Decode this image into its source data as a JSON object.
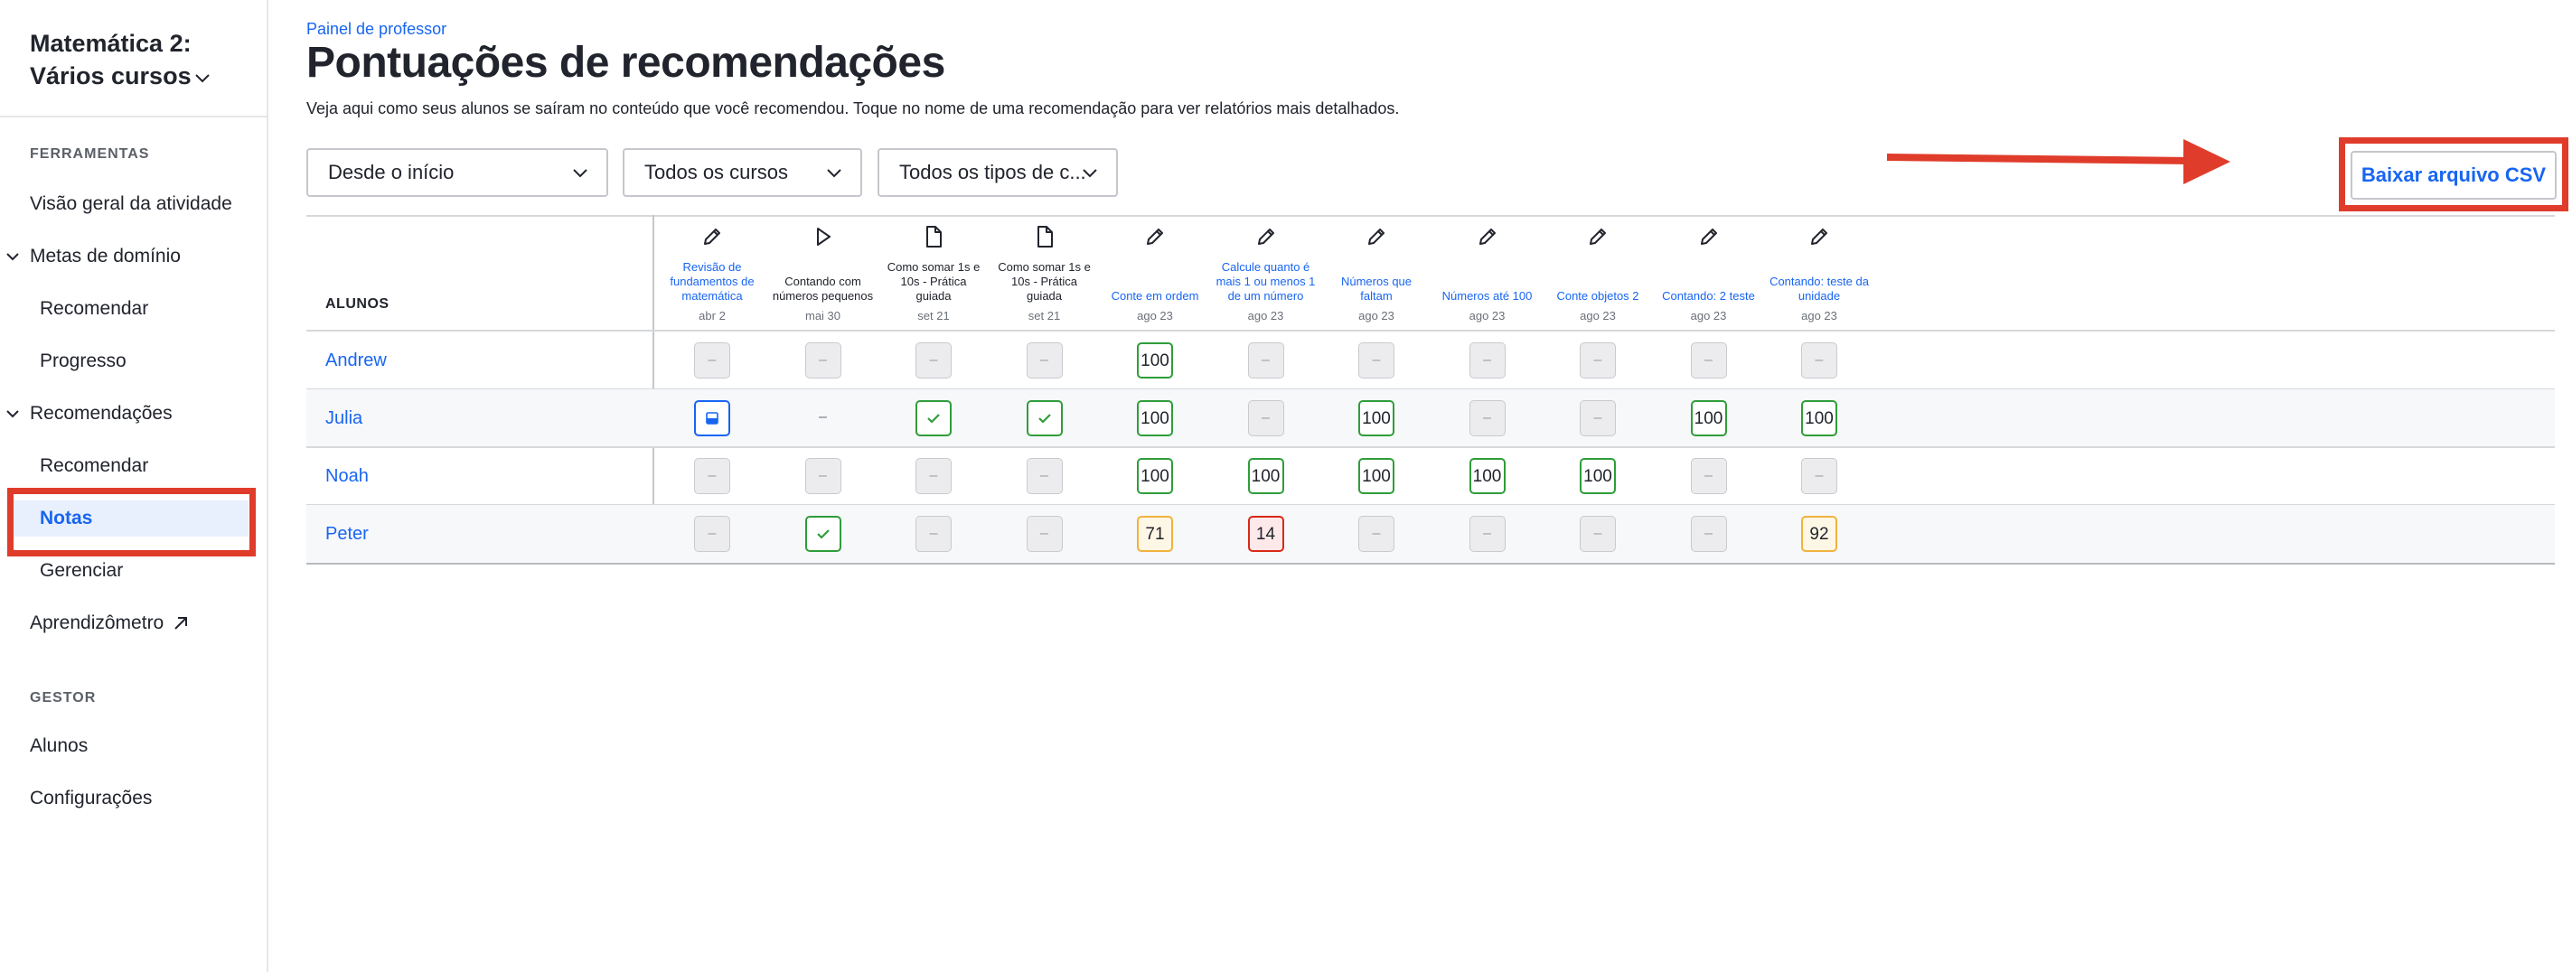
{
  "sidebar": {
    "course_title_line1": "Matemática 2:",
    "course_title_line2": "Vários cursos",
    "section_tools": "FERRAMENTAS",
    "activity_overview": "Visão geral da atividade",
    "mastery_goals": "Metas de domínio",
    "mastery_recommend": "Recomendar",
    "mastery_progress": "Progresso",
    "recommendations": "Recomendações",
    "rec_recommend": "Recomendar",
    "rec_grades": "Notas",
    "rec_manage": "Gerenciar",
    "learnometer": "Aprendizômetro",
    "section_manager": "GESTOR",
    "students": "Alunos",
    "settings": "Configurações"
  },
  "header": {
    "breadcrumb": "Painel de professor",
    "title": "Pontuações de recomendações",
    "description": "Veja aqui como seus alunos se saíram no conteúdo que você recomendou. Toque no nome de uma recomendação para ver relatórios mais detalhados."
  },
  "filters": {
    "period": "Desde o início",
    "courses": "Todos os cursos",
    "types": "Todos os tipos de c..."
  },
  "csv_button": "Baixar arquivo CSV",
  "colors": {
    "link_blue": "#1865f2",
    "annotation_red": "#e03c2b",
    "score_green": "#2f9d3a",
    "score_yellow": "#f0b33c",
    "score_red": "#d92916"
  },
  "table": {
    "students_header": "ALUNOS",
    "assignments": [
      {
        "icon": "pencil-icon",
        "lines": [
          "Revisão de",
          "fundamentos de",
          "matemática"
        ],
        "date": "abr 2",
        "link": true
      },
      {
        "icon": "play-icon",
        "lines": [
          "Contando com",
          "números pequenos"
        ],
        "date": "mai 30",
        "link": false
      },
      {
        "icon": "document-icon",
        "lines": [
          "Como somar 1s e",
          "10s - Prática",
          "guiada"
        ],
        "date": "set 21",
        "link": false
      },
      {
        "icon": "document-icon",
        "lines": [
          "Como somar 1s e",
          "10s - Prática",
          "guiada"
        ],
        "date": "set 21",
        "link": false
      },
      {
        "icon": "pencil-icon",
        "lines": [
          "Conte em ordem"
        ],
        "date": "ago 23",
        "link": true
      },
      {
        "icon": "pencil-icon",
        "lines": [
          "Calcule quanto é",
          "mais 1 ou menos 1",
          "de um número"
        ],
        "date": "ago 23",
        "link": true
      },
      {
        "icon": "pencil-icon",
        "lines": [
          "Números que",
          "faltam"
        ],
        "date": "ago 23",
        "link": true
      },
      {
        "icon": "pencil-icon",
        "lines": [
          "Números até 100"
        ],
        "date": "ago 23",
        "link": true
      },
      {
        "icon": "pencil-icon",
        "lines": [
          "Conte objetos 2"
        ],
        "date": "ago 23",
        "link": true
      },
      {
        "icon": "pencil-icon",
        "lines": [
          "Contando: 2 teste"
        ],
        "date": "ago 23",
        "link": true
      },
      {
        "icon": "pencil-icon",
        "lines": [
          "Contando: teste da",
          "unidade"
        ],
        "date": "ago 23",
        "link": true
      }
    ],
    "rows": [
      {
        "name": "Andrew",
        "cells": [
          {
            "s": "none",
            "t": "–"
          },
          {
            "s": "none",
            "t": "–"
          },
          {
            "s": "none",
            "t": "–"
          },
          {
            "s": "none",
            "t": "–"
          },
          {
            "s": "green",
            "t": "100"
          },
          {
            "s": "none",
            "t": "–"
          },
          {
            "s": "none",
            "t": "–"
          },
          {
            "s": "none",
            "t": "–"
          },
          {
            "s": "none",
            "t": "–"
          },
          {
            "s": "none",
            "t": "–"
          },
          {
            "s": "none",
            "t": "–"
          }
        ]
      },
      {
        "name": "Julia",
        "cells": [
          {
            "s": "blue",
            "t": "",
            "icon": "in-progress-icon"
          },
          {
            "s": "dash",
            "t": "–"
          },
          {
            "s": "green",
            "t": "",
            "icon": "check-icon"
          },
          {
            "s": "green",
            "t": "",
            "icon": "check-icon"
          },
          {
            "s": "green",
            "t": "100"
          },
          {
            "s": "none",
            "t": "–"
          },
          {
            "s": "green",
            "t": "100"
          },
          {
            "s": "none",
            "t": "–"
          },
          {
            "s": "none",
            "t": "–"
          },
          {
            "s": "green",
            "t": "100"
          },
          {
            "s": "green",
            "t": "100"
          }
        ]
      },
      {
        "name": "Noah",
        "cells": [
          {
            "s": "none",
            "t": "–"
          },
          {
            "s": "none",
            "t": "–"
          },
          {
            "s": "none",
            "t": "–"
          },
          {
            "s": "none",
            "t": "–"
          },
          {
            "s": "green",
            "t": "100"
          },
          {
            "s": "green",
            "t": "100"
          },
          {
            "s": "green",
            "t": "100"
          },
          {
            "s": "green",
            "t": "100"
          },
          {
            "s": "green",
            "t": "100"
          },
          {
            "s": "none",
            "t": "–"
          },
          {
            "s": "none",
            "t": "–"
          }
        ]
      },
      {
        "name": "Peter",
        "cells": [
          {
            "s": "none",
            "t": "–"
          },
          {
            "s": "green",
            "t": "",
            "icon": "check-icon"
          },
          {
            "s": "none",
            "t": "–"
          },
          {
            "s": "none",
            "t": "–"
          },
          {
            "s": "yellow",
            "t": "71"
          },
          {
            "s": "red",
            "t": "14"
          },
          {
            "s": "none",
            "t": "–"
          },
          {
            "s": "none",
            "t": "–"
          },
          {
            "s": "none",
            "t": "–"
          },
          {
            "s": "none",
            "t": "–"
          },
          {
            "s": "yellow",
            "t": "92"
          }
        ]
      }
    ]
  }
}
